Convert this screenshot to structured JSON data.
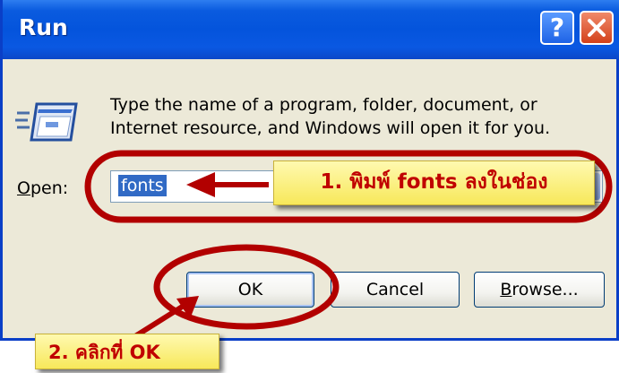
{
  "window": {
    "title": "Run",
    "help_button": "?",
    "description": "Type the name of a program, folder, document, or Internet resource, and Windows will open it for you."
  },
  "open_field": {
    "label_underlined": "O",
    "label_rest": "pen:",
    "value": "fonts"
  },
  "buttons": {
    "ok": "OK",
    "cancel": "Cancel",
    "browse_underlined": "B",
    "browse_rest": "rowse..."
  },
  "annotations": {
    "step1": "1. พิมพ์ fonts ลงในช่อง",
    "step2": "2. คลิกที่ OK"
  },
  "colors": {
    "titlebar": "#0454dc",
    "annotation_outline": "#b20000",
    "callout_bg": "#f7e85a",
    "callout_text": "#c00000"
  },
  "icons": [
    "run-program-icon",
    "help-icon",
    "close-icon",
    "dropdown-arrow-icon"
  ]
}
